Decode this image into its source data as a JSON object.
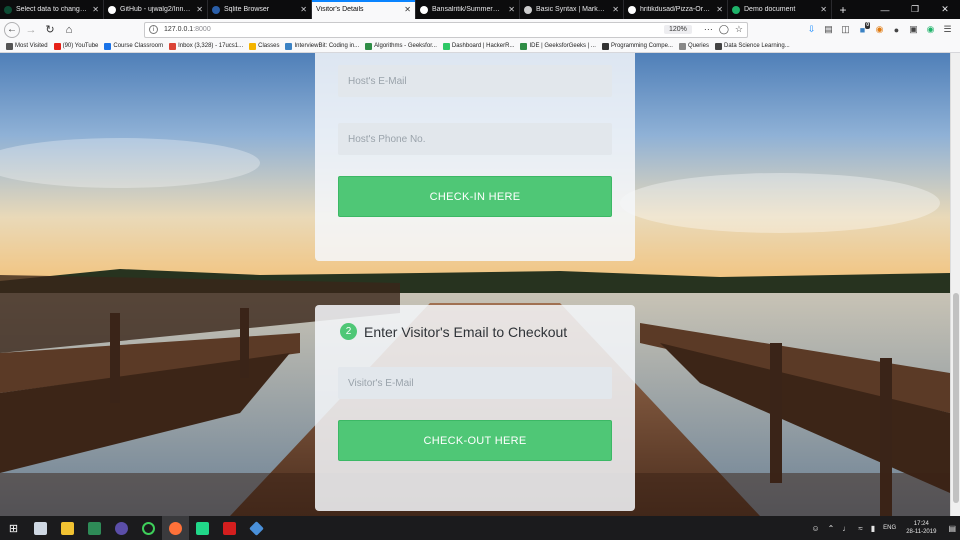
{
  "tabs": [
    {
      "label": "Select data to change | Djan",
      "icon_color": "#0c4b33",
      "active": false
    },
    {
      "label": "GitHub - ujwalg2/Innova",
      "icon_color": "#ffffff",
      "active": false
    },
    {
      "label": "Sqlite Browser",
      "icon_color": "#2a5ea8",
      "active": false
    },
    {
      "label": "Visitor's Details",
      "icon_color": "",
      "active": true
    },
    {
      "label": "Bansalritik/SummerGeek",
      "icon_color": "#ffffff",
      "active": false
    },
    {
      "label": "Basic Syntax | Markdown",
      "icon_color": "#cccccc",
      "active": false
    },
    {
      "label": "hritikdusad/Pizza-Order",
      "icon_color": "#ffffff",
      "active": false
    },
    {
      "label": "Demo document",
      "icon_color": "#1fb36a",
      "active": false
    }
  ],
  "nav": {
    "url_host": "127.0.0.1",
    "url_port": ":8000",
    "zoom": "120%",
    "extension_badge": "0"
  },
  "bookmarks": [
    {
      "label": "Most Visited",
      "icon_color": "#555555"
    },
    {
      "label": "(90) YouTube",
      "icon_color": "#e62117"
    },
    {
      "label": "Course Classroom",
      "icon_color": "#1a73e8"
    },
    {
      "label": "Inbox (3,328) - 17ucs1...",
      "icon_color": "#db4437"
    },
    {
      "label": "Classes",
      "icon_color": "#f4b400"
    },
    {
      "label": "InterviewBit: Coding in...",
      "icon_color": "#3b82c4"
    },
    {
      "label": "Algorithms - Geeksfor...",
      "icon_color": "#2f8d46"
    },
    {
      "label": "Dashboard | HackerR...",
      "icon_color": "#2ec866"
    },
    {
      "label": "IDE | GeeksforGeeks | ...",
      "icon_color": "#2f8d46"
    },
    {
      "label": "Programming Compe...",
      "icon_color": "#333333"
    },
    {
      "label": "Queries",
      "icon_color": "#888888"
    },
    {
      "label": "Data Science Learning...",
      "icon_color": "#444444"
    }
  ],
  "checkin_card": {
    "host_email_placeholder": "Host's E-Mail",
    "host_phone_placeholder": "Host's Phone No.",
    "checkin_button": "CHECK-IN HERE"
  },
  "checkout_card": {
    "step_number": "2",
    "title": "Enter Visitor's Email to Checkout",
    "visitor_email_placeholder": "Visitor's E-Mail",
    "checkout_button": "CHECK-OUT HERE"
  },
  "taskbar": {
    "language": "ENG",
    "time": "17:24",
    "date": "28-11-2019"
  },
  "colors": {
    "accent_green": "#4fc776",
    "tab_bar": "#0c0c0d",
    "active_tab_indicator": "#0a84ff"
  }
}
